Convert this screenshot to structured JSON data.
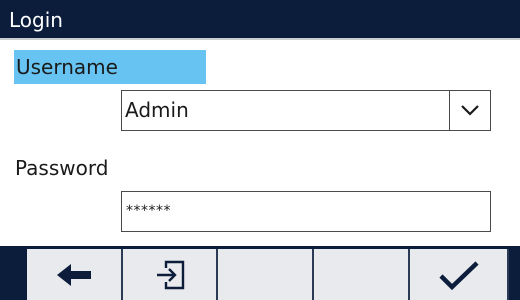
{
  "window": {
    "title": "Login"
  },
  "form": {
    "username": {
      "label": "Username",
      "value": "Admin",
      "toggle_icon": "chevron-down-icon"
    },
    "password": {
      "label": "Password",
      "value": "******"
    }
  },
  "softkeys": [
    {
      "icon": "arrow-left-icon"
    },
    {
      "icon": "exit-icon"
    },
    {
      "icon": ""
    },
    {
      "icon": ""
    },
    {
      "icon": "checkmark-icon"
    }
  ],
  "colors": {
    "title_bar": "#0c1d3b",
    "selection_highlight": "#67c4f2",
    "softkey_background": "#e8eaed",
    "softkey_icon": "#0c1d3b"
  }
}
